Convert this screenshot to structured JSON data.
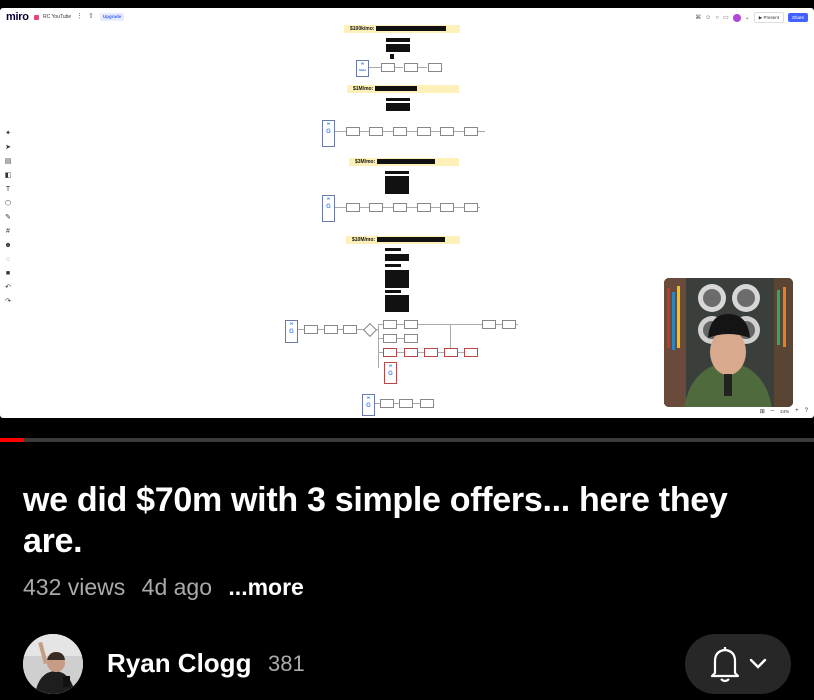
{
  "miro": {
    "logo": "miro",
    "board_name": "RC YouTube",
    "upgrade_label": "Upgrade",
    "present_label": "Present",
    "share_label": "Share",
    "zoom_level": "24%",
    "stages": [
      {
        "label": "$100k/mo:"
      },
      {
        "label": "$1M/mo:"
      },
      {
        "label": "$3M/mo:"
      },
      {
        "label": "$10M/mo:"
      }
    ],
    "accent_color": "#4262ff",
    "highlight_color": "#fdf0b8"
  },
  "video": {
    "progress_fraction": 0.03,
    "title": "we did $70m with 3 simple offers... here they are.",
    "views": "432 views",
    "age": "4d ago",
    "more_label": "...more"
  },
  "channel": {
    "name": "Ryan Clogg",
    "subscribers": "381"
  },
  "icons": {
    "bell": "bell-icon",
    "chevron": "chevron-down-icon"
  }
}
